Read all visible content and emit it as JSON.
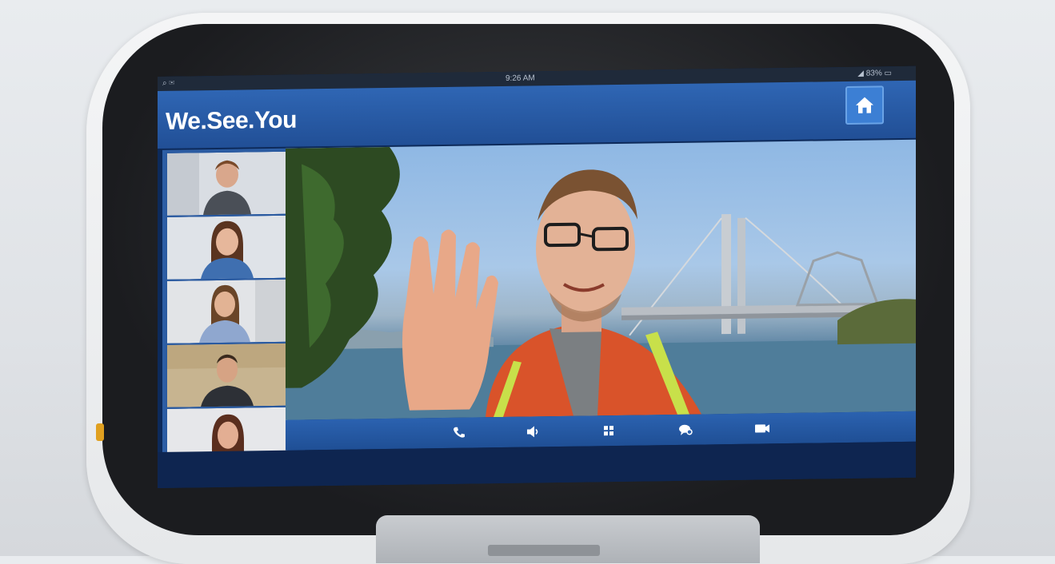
{
  "status_bar": {
    "left_icons": "⌕ ✉",
    "time": "9:26 AM",
    "right_indicators": "◢ 83% ▭"
  },
  "app": {
    "title": "We.See.You"
  },
  "icons": {
    "home": "home-icon",
    "phone": "phone-icon",
    "volume": "volume-icon",
    "grid": "grid-icon",
    "chat": "chat-icon",
    "video": "video-icon"
  },
  "colors": {
    "brand_blue": "#2f66b4",
    "title_text": "#ffffff",
    "accent": "#e0a020"
  },
  "participants": [
    {
      "id": "participant-1"
    },
    {
      "id": "participant-2"
    },
    {
      "id": "participant-3"
    },
    {
      "id": "participant-4"
    },
    {
      "id": "participant-5"
    }
  ]
}
